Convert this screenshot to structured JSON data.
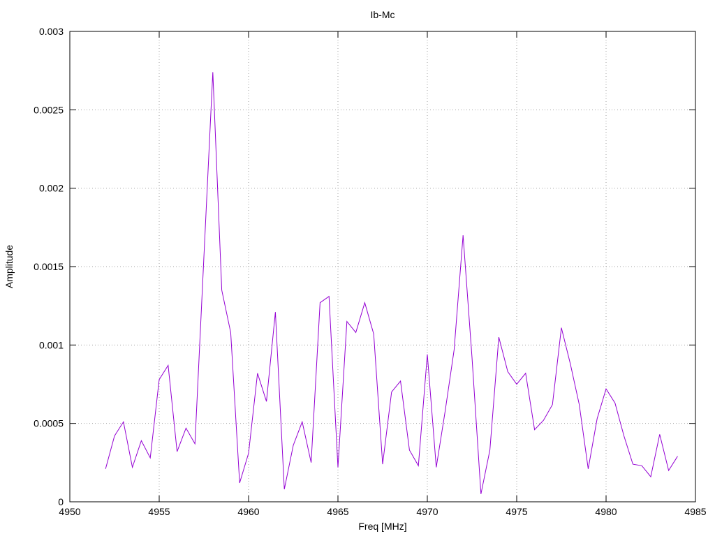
{
  "chart_data": {
    "type": "line",
    "title": "Ib-Mc",
    "xlabel": "Freq [MHz]",
    "ylabel": "Amplitude",
    "xlim": [
      4950,
      4985
    ],
    "ylim": [
      0,
      0.003
    ],
    "xticks": [
      "4950",
      "4955",
      "4960",
      "4965",
      "4970",
      "4975",
      "4980",
      "4985"
    ],
    "yticks": [
      "0",
      "0.0005",
      "0.001",
      "0.0015",
      "0.002",
      "0.0025",
      "0.003"
    ],
    "grid": true,
    "legend": "none",
    "line_color": "#9400d3",
    "series": [
      {
        "x": [
          4952,
          4952.5,
          4953,
          4953.5,
          4954,
          4954.5,
          4955,
          4955.5,
          4956,
          4956.5,
          4957,
          4957.5,
          4958,
          4958.5,
          4959,
          4959.5,
          4960,
          4960.5,
          4961,
          4961.5,
          4962,
          4962.5,
          4963,
          4963.5,
          4964,
          4964.5,
          4965,
          4965.5,
          4966,
          4966.5,
          4967,
          4967.5,
          4968,
          4968.5,
          4969,
          4969.5,
          4970,
          4970.5,
          4971,
          4971.5,
          4972,
          4972.5,
          4973,
          4973.5,
          4974,
          4974.5,
          4975,
          4975.5,
          4976,
          4976.5,
          4977,
          4977.5,
          4978,
          4978.5,
          4979,
          4979.5,
          4980,
          4980.5,
          4981,
          4981.5,
          4982,
          4982.5,
          4983,
          4983.5,
          4984
        ],
        "y": [
          0.00021,
          0.00042,
          0.00051,
          0.00022,
          0.00039,
          0.00028,
          0.00078,
          0.00087,
          0.00032,
          0.00047,
          0.00037,
          0.00156,
          0.00274,
          0.00135,
          0.00108,
          0.00012,
          0.00031,
          0.00082,
          0.00064,
          0.00121,
          8e-05,
          0.00036,
          0.00051,
          0.00025,
          0.00127,
          0.00131,
          0.00022,
          0.00115,
          0.00108,
          0.00127,
          0.00107,
          0.00024,
          0.0007,
          0.00077,
          0.00033,
          0.00023,
          0.00094,
          0.00022,
          0.00058,
          0.00097,
          0.0017,
          0.00092,
          5e-05,
          0.00033,
          0.00105,
          0.00083,
          0.00075,
          0.00082,
          0.00046,
          0.00052,
          0.00062,
          0.00111,
          0.00088,
          0.00062,
          0.00021,
          0.00053,
          0.00072,
          0.00063,
          0.00042,
          0.00024,
          0.00023,
          0.00016,
          0.00043,
          0.0002,
          0.00029
        ]
      }
    ]
  }
}
